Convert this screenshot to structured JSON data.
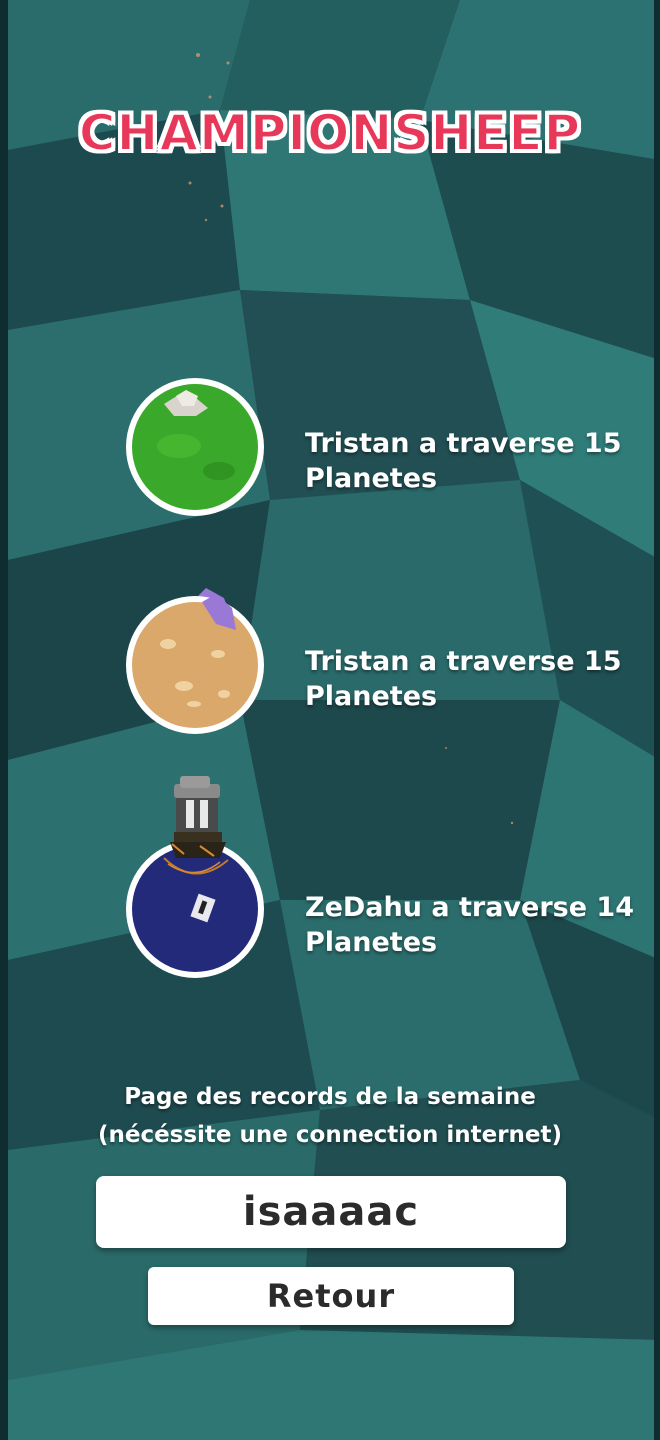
{
  "game": {
    "title": "CHAMPIONSHEEP"
  },
  "records": [
    {
      "text": "Tristan a traverse 15 Planetes",
      "planet_icon": "grass-planet-icon",
      "planet_color": "#3aa82a"
    },
    {
      "text": "Tristan a traverse 15 Planetes",
      "planet_icon": "sand-planet-icon",
      "planet_color": "#d9a86a"
    },
    {
      "text": "ZeDahu a traverse 14 Planetes",
      "planet_icon": "space-station-planet-icon",
      "planet_color": "#232a7a"
    }
  ],
  "footer": {
    "caption_line1": "Page des records de la semaine",
    "caption_line2": "(nécéssite une connection internet)",
    "player_name": "isaaaac",
    "back_label": "Retour"
  },
  "colors": {
    "title": "#e8385a",
    "background": "#1f4f52",
    "panel": "#ffffff"
  }
}
